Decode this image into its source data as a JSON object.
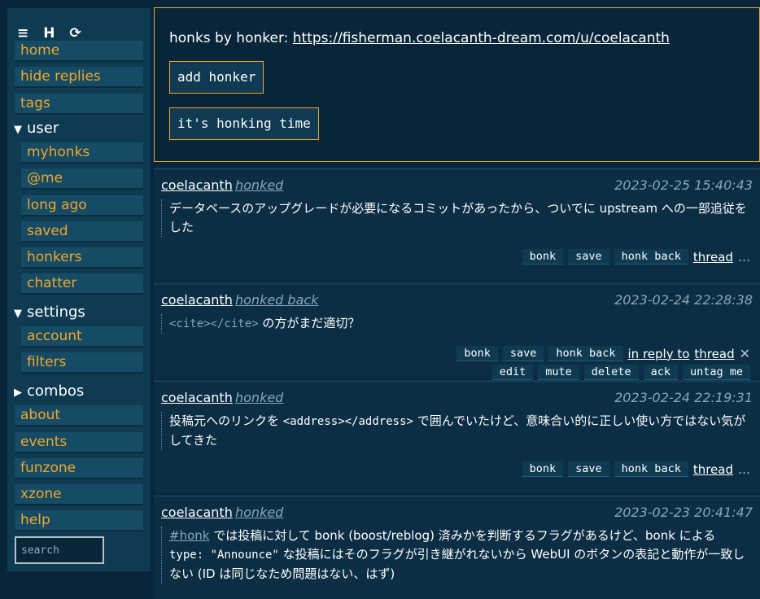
{
  "sidebar": {
    "icons": {
      "menu": "≡",
      "home_h": "H",
      "refresh": "⟳"
    },
    "items": [
      "home",
      "hide replies",
      "tags"
    ],
    "user_label": "user",
    "user_items": [
      "myhonks",
      "@me",
      "long ago",
      "saved",
      "honkers",
      "chatter"
    ],
    "settings_label": "settings",
    "settings_items": [
      "account",
      "filters"
    ],
    "combos_label": "combos",
    "bottom_items": [
      "about",
      "events",
      "funzone",
      "xzone",
      "help"
    ],
    "search_placeholder": "search"
  },
  "info": {
    "text": "honks by honker: ",
    "url": "https://fisherman.coelacanth-dream.com/u/coelacanth",
    "add_honker": "add honker",
    "honking_time": "it's honking time"
  },
  "honks": [
    {
      "author": "coelacanth",
      "verb": "honked",
      "date": "2023-02-25 15:40:43",
      "text": "データベースのアップグレードが必要になるコミットがあったから、ついでに upstream への一部追従をした"
    },
    {
      "author": "coelacanth",
      "verb": "honked back",
      "date": "2023-02-24 22:28:38",
      "code": "<cite></cite>",
      "text": " の方がまだ適切？"
    },
    {
      "author": "coelacanth",
      "verb": "honked",
      "date": "2023-02-24 22:19:31",
      "text_a": "投稿元へのリンクを ",
      "code": "<address></address>",
      "text_b": " で囲んでいたけど、意味合い的に正しい使い方ではない気がしてきた"
    },
    {
      "author": "coelacanth",
      "verb": "honked",
      "date": "2023-02-23 20:41:47",
      "hashtag": "#honk",
      "text_a": " では投稿に対して bonk (boost/reblog) 済みかを判断するフラグがあるけど、bonk による ",
      "code": "type: \"Announce\"",
      "text_b": " な投稿にはそのフラグが引き継がれないから WebUI のボタンの表記と動作が一致しない (ID は同じなため問題はない、はず)"
    }
  ],
  "actions": {
    "bonk": "bonk",
    "save": "save",
    "honk_back": "honk back",
    "in_reply_to": "in reply to",
    "thread": "thread",
    "more": "…",
    "close": "✕",
    "edit": "edit",
    "mute": "mute",
    "delete": "delete",
    "ack": "ack",
    "untag_me": "untag me"
  }
}
